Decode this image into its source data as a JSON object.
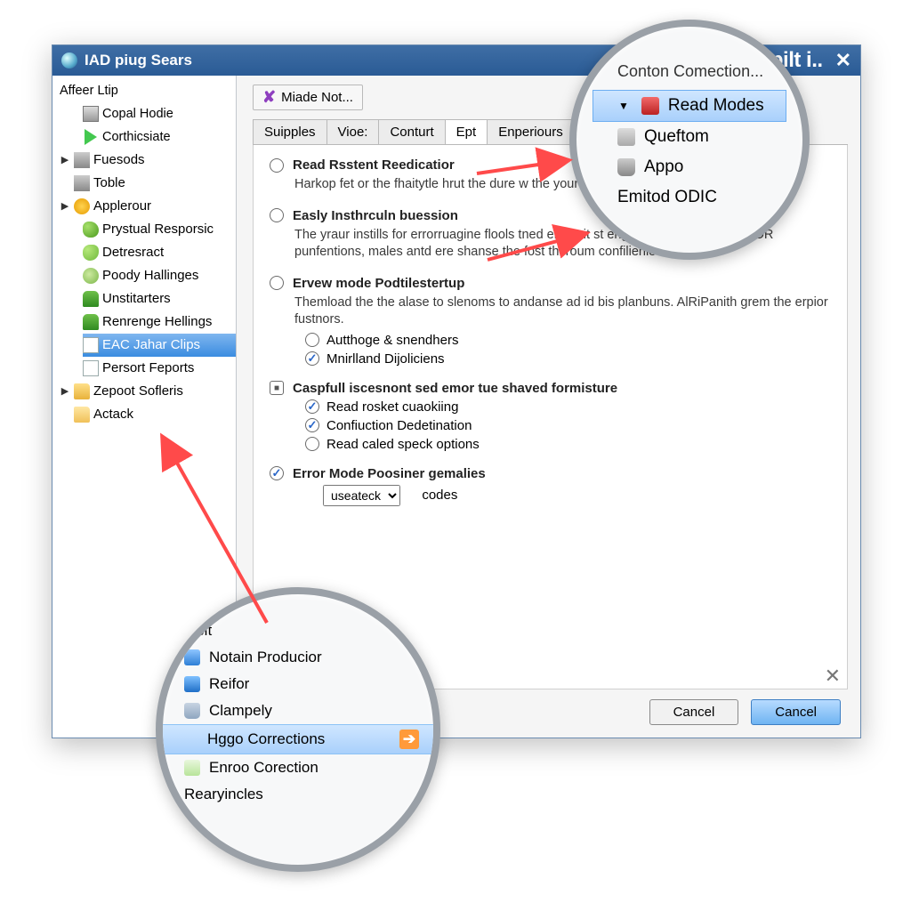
{
  "window": {
    "title": "IAD piug Sears",
    "caplift": "yid capilt i.."
  },
  "sidebar": {
    "root_label": "Affeer Ltip",
    "items": [
      {
        "label": "Copal Hodie"
      },
      {
        "label": "Corthicsiate"
      }
    ],
    "nodes": [
      {
        "label": "Fuesods"
      },
      {
        "label": "Toble"
      },
      {
        "label": "Applerour",
        "children": [
          {
            "label": "Prystual Resporsic"
          },
          {
            "label": "Detresract"
          },
          {
            "label": "Poody Hallinges"
          },
          {
            "label": "Unstitarters"
          },
          {
            "label": "Renrenge Hellings"
          },
          {
            "label": "EAC Jahar Clips",
            "selected": true
          },
          {
            "label": "Persort Feports"
          }
        ]
      },
      {
        "label": "Zepoot Sofleris"
      },
      {
        "label": "Actack"
      }
    ]
  },
  "content": {
    "made_button": "Miade Not...",
    "tabs": [
      "Suipples",
      "Vioe:",
      "Conturt",
      "Ept",
      "Enperiours"
    ],
    "active_tab": "Ept",
    "opt1": {
      "title": "Read Rsstent Reedicatior",
      "desc": "Harkop fet or the fhaitytle hrut the dure w the your mauulis the barten to coniect gr"
    },
    "opt2": {
      "title": "Easly Insthrculn buession",
      "desc": "The yraur instills for errorruagine flools tned erfout it st engoning aapaidar, ase ODR punfentions, males antd ere shanse the fost thcroum confilienie s..."
    },
    "opt3": {
      "title": "Ervew mode Podtilestertup",
      "desc": "Themload the the alase to slenoms to andanse ad id bis planbuns. AlRiPanith grem the erpior fustnors.",
      "sub1": "Autthoge & snendhers",
      "sub2": "Mnirlland Dijoliciens"
    },
    "opt4": {
      "title": "Caspfull iscesnont sed emor tue shaved formisture",
      "sub1": "Read rosket cuaokiing",
      "sub2": "Confiuction Dedetination",
      "sub3": "Read caled speck options"
    },
    "opt5": {
      "title": "Error Mode Poosiner gemalies",
      "select": "useateck",
      "codes": "codes"
    },
    "btn_cancel": "Cancel",
    "btn_ok": "Cancel"
  },
  "bubble_top": {
    "header": "Conton Comection...",
    "sel": "Read Modes",
    "i2": "Queftom",
    "i3": "Appo",
    "i4": "Emitod ODIC"
  },
  "bubble_bot": {
    "i0": "ttibit",
    "i1": "Notain Producior",
    "i2": "Reifor",
    "i3": "Clampely",
    "sel": "Hggo Corrections",
    "i5": "Enroo Corection",
    "i6": "Rearyincles"
  }
}
